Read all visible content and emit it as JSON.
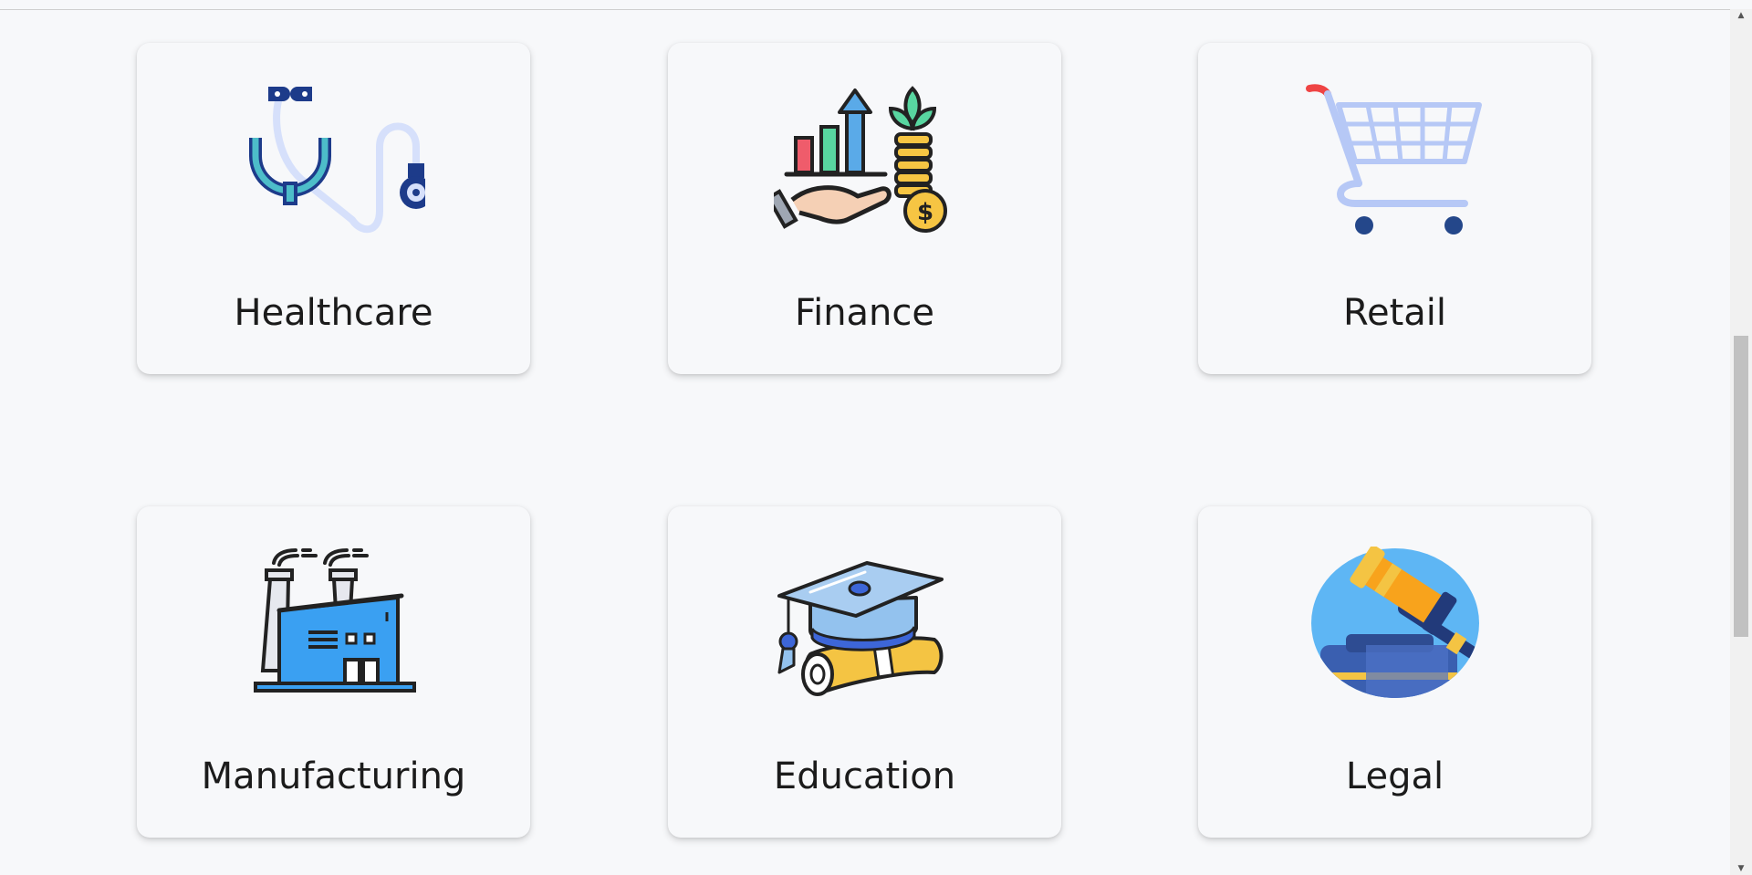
{
  "cards": [
    {
      "label": "Healthcare",
      "icon": "stethoscope-icon"
    },
    {
      "label": "Finance",
      "icon": "finance-growth-icon"
    },
    {
      "label": "Retail",
      "icon": "shopping-cart-icon"
    },
    {
      "label": "Manufacturing",
      "icon": "factory-icon"
    },
    {
      "label": "Education",
      "icon": "graduation-cap-icon"
    },
    {
      "label": "Legal",
      "icon": "gavel-icon"
    }
  ],
  "scrollbar": {
    "up_arrow": "▲",
    "down_arrow": "▼"
  },
  "colors": {
    "background": "#f7f8fa",
    "text": "#1b1b1b",
    "card_shadow": "rgba(0,0,0,0.16)"
  }
}
